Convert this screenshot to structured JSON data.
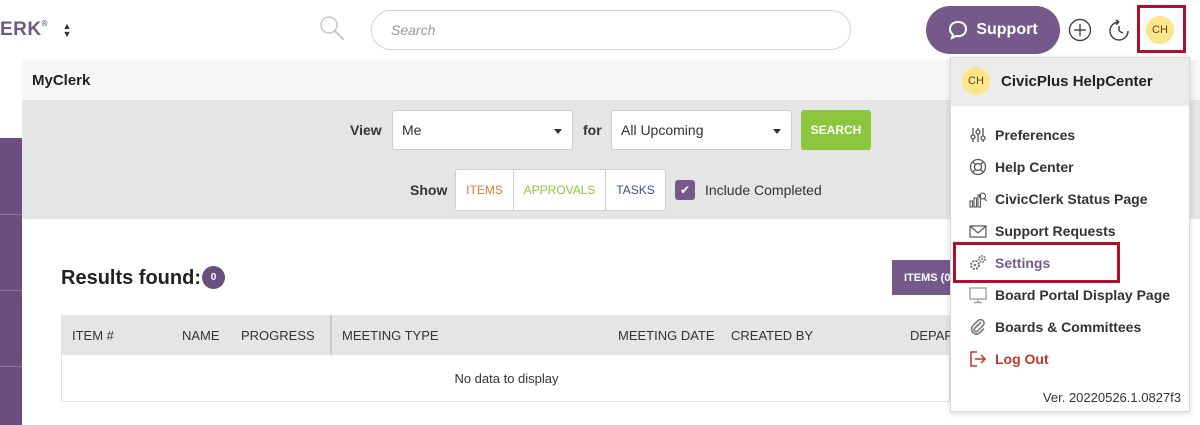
{
  "header": {
    "brand": "ERK",
    "search_placeholder": "Search",
    "support_label": "Support",
    "avatar_initials": "CH"
  },
  "page": {
    "title": "MyClerk"
  },
  "filters": {
    "view_label": "View",
    "view_value": "Me",
    "for_label": "for",
    "for_value": "All Upcoming",
    "search_button": "SEARCH",
    "show_label": "Show",
    "show_options": [
      "ITEMS",
      "APPROVALS",
      "TASKS"
    ],
    "include_completed_label": "Include Completed",
    "include_completed_checked": true
  },
  "results": {
    "title": "Results found:",
    "count": "0",
    "items_button": "ITEMS (0",
    "columns": [
      "ITEM #",
      "NAME",
      "PROGRESS",
      "MEETING TYPE",
      "MEETING DATE",
      "CREATED BY",
      "DEPAR"
    ],
    "empty_text": "No data to display"
  },
  "user_menu": {
    "avatar_initials": "CH",
    "user_name": "CivicPlus HelpCenter",
    "items": [
      {
        "label": "Preferences",
        "icon": "sliders-icon"
      },
      {
        "label": "Help Center",
        "icon": "lifebuoy-icon"
      },
      {
        "label": "CivicClerk Status Page",
        "icon": "status-chart-icon"
      },
      {
        "label": "Support Requests",
        "icon": "envelope-icon"
      },
      {
        "label": "Settings",
        "icon": "gears-icon"
      },
      {
        "label": "Board Portal Display Page",
        "icon": "monitor-icon"
      },
      {
        "label": "Boards & Committees",
        "icon": "paperclip-icon"
      },
      {
        "label": "Log Out",
        "icon": "logout-icon"
      }
    ],
    "version": "Ver. 20220526.1.0827f3"
  },
  "colors": {
    "brand_purple": "#76598b",
    "search_green": "#8cc63f",
    "items_orange": "#e27d2a",
    "tasks_blue": "#3c4a9a",
    "highlight_red": "#b30f2c",
    "avatar_yellow": "#fde58a"
  }
}
